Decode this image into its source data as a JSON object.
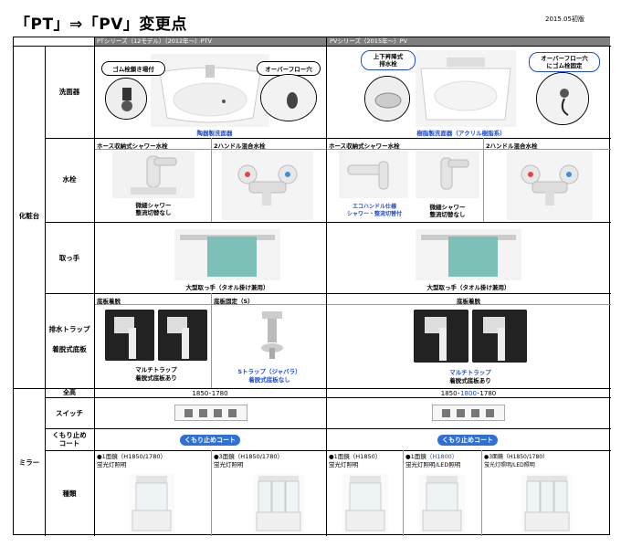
{
  "header": {
    "title": "「PT」⇒「PV」変更点",
    "edition": "2015.05初版"
  },
  "columns": {
    "pt": "PTシリーズ（12モデル）（2012年～）PTV",
    "pv": "PVシリーズ（2015年～）PV"
  },
  "sections": {
    "vanity": "化粧台",
    "mirror": "ミラー"
  },
  "rows": {
    "sink": "洗面器",
    "faucet": "水栓",
    "handle": "取っ手",
    "drain": [
      "排水トラップ",
      "着脱式底板"
    ],
    "height": "全高",
    "switch": "スイッチ",
    "antifog": "くもり止め\nコート",
    "types": "種類"
  },
  "sink": {
    "pt_callout_left": "ゴム栓鎖き場付",
    "pt_callout_right": "オーバーフロー穴",
    "pt_caption": "陶器製洗面器",
    "pv_callout_left": "上下昇降式\n排水栓",
    "pv_callout_right": "オーバーフロー穴\nにゴム栓固定",
    "pv_caption": "樹脂製洗面器（アクリル樹脂系）"
  },
  "faucet": {
    "pt_a_title": "ホース収納式シャワー水栓",
    "pt_a_caption": "微細シャワー\n整流切替なし",
    "pt_b_title": "2ハンドル混合水栓",
    "pv_a_title": "ホース収納式シャワー水栓",
    "pv_a1_caption": "エコハンドル仕様\nシャワー・整流切替付",
    "pv_a2_caption": "微細シャワー\n整流切替なし",
    "pv_b_title": "2ハンドル混合水栓"
  },
  "handle": {
    "pt_caption": "大型取っ手（タオル掛け兼用）",
    "pv_caption": "大型取っ手（タオル掛け兼用）"
  },
  "drain": {
    "pt_a_title": "底板着脱",
    "pt_b_title": "底板固定（S）",
    "pt_a_caption": "マルチトラップ\n着脱式底板あり",
    "pt_b_caption_1": "Sトラップ（ジャバラ）",
    "pt_b_caption_2": "着脱式底板なし",
    "pv_title": "底板着脱",
    "pv_caption_1": "マルチトラップ",
    "pv_caption_2": "着脱式底板あり"
  },
  "mirror": {
    "pt_height": "1850･1780",
    "pv_height_a": "1850･",
    "pv_height_b": "1800",
    "pv_height_c": "･1780",
    "antifog_badge": "くもり止めコート",
    "pt_type_1": "●1面鏡（H1850/1780）\n蛍光灯照明",
    "pt_type_3": "●3面鏡（H1850/1780）\n蛍光灯照明",
    "pv_type_1": "●1面鏡（H1850）\n蛍光灯照明",
    "pv_type_2a": "●1面鏡",
    "pv_type_2b": "（H1800）",
    "pv_type_2c": "蛍光灯照明/LED照明",
    "pv_type_3": "●3面鏡（H1850/1780）\n蛍光灯照明/LED照明"
  },
  "colors": {
    "accent_blue": "#1c4bd6",
    "header_gray": "#7f7f7f",
    "badge_blue": "#2f70d8"
  }
}
